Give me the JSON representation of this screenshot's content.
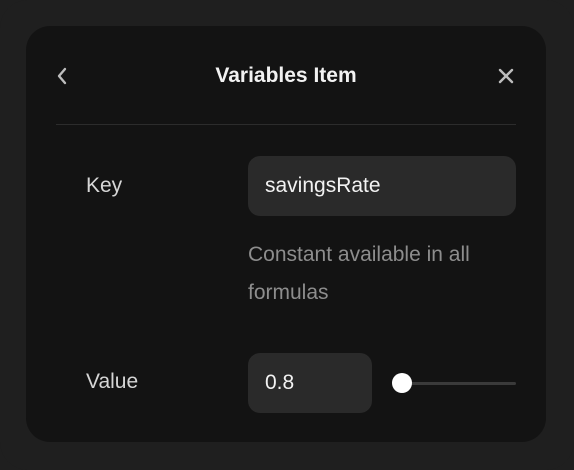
{
  "dialog": {
    "title": "Variables Item",
    "back_icon": "chevron-left-icon",
    "close_icon": "close-icon"
  },
  "key_field": {
    "label": "Key",
    "value": "savingsRate",
    "helper": "Constant available in all formulas"
  },
  "value_field": {
    "label": "Value",
    "value": "0.8",
    "slider_fraction": 0.0
  },
  "colors": {
    "background": "#1f1f1f",
    "panel": "#131313",
    "input_bg": "#2a2a2a",
    "text": "#f2f2f2",
    "muted": "#8d8d8d",
    "track": "#3a3a3a",
    "thumb": "#ffffff"
  }
}
